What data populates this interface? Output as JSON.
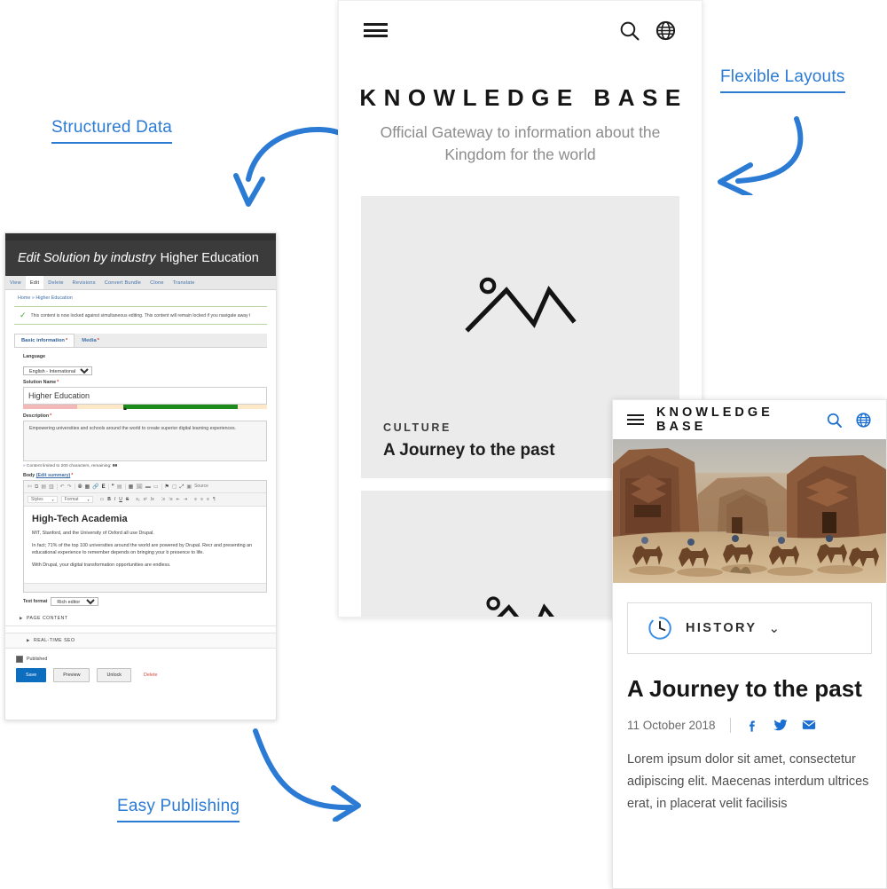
{
  "annotations": [
    {
      "id": "structured",
      "label": "Structured Data"
    },
    {
      "id": "flexible",
      "label": "Flexible Layouts"
    },
    {
      "id": "easy",
      "label": "Easy Publishing"
    }
  ],
  "colors": {
    "annotation_blue": "#2b7bd4",
    "primary_button": "#0d6dbf",
    "delete_link": "#d4483c",
    "required_star": "#d43a2f",
    "link_blue": "#3f6fa8",
    "success_green": "#4d9e3e",
    "social_blue": "#1b6fd0"
  },
  "drupal": {
    "title_emphasis": "Edit Solution by industry",
    "title_name": "Higher Education",
    "tabs": [
      {
        "label": "View",
        "active": false
      },
      {
        "label": "Edit",
        "active": true
      },
      {
        "label": "Delete",
        "active": false
      },
      {
        "label": "Revisions",
        "active": false
      },
      {
        "label": "Convert Bundle",
        "active": false
      },
      {
        "label": "Clone",
        "active": false
      },
      {
        "label": "Translate",
        "active": false
      }
    ],
    "breadcrumb": "Home » Higher Education",
    "status_message": "This content is now locked against simultaneous editing. This content will remain locked if you navigate away f",
    "field_tabs": [
      {
        "label": "Basic information",
        "required": true,
        "active": true
      },
      {
        "label": "Media",
        "required": true,
        "active": false
      }
    ],
    "fields": {
      "language_label": "Language",
      "language_value": "English - International",
      "solution_name_label": "Solution Name",
      "solution_name_value": "Higher Education",
      "description_label": "Description",
      "description_value": "Empowering universities and schools around the world to create superior digital learning experiences.",
      "description_help_prefix": "Content limited to 200 characters, remaining:",
      "description_remaining": "99",
      "body_label": "Body",
      "body_edit_summary": "(Edit summary)",
      "text_format_label": "Text format",
      "text_format_value": "Rich editor"
    },
    "editor": {
      "toolbar_row1": [
        "✂",
        "⧉",
        "📋",
        "🗐",
        "↶",
        "↷",
        "🔍",
        "🔁",
        "🔗",
        "E",
        "❞",
        "⬚",
        "▦",
        "🏳",
        "▬",
        "▭",
        "⚑",
        "⬚",
        "⤧",
        "Source"
      ],
      "toolbar_row2_styles": "Styles",
      "toolbar_row2_format": "Format",
      "toolbar_row2_items": [
        "▭",
        "B",
        "I",
        "U",
        "S",
        "x₂",
        "x²",
        "Ix",
        "⁝≡",
        "⁞≡",
        "⇤",
        "⇥",
        "≡",
        "≡",
        "≡",
        "¶"
      ],
      "heading": "High-Tech Academia",
      "paragraphs": [
        "MIT, Stanford, and the University of Oxford all use Drupal.",
        "In fact; 71% of the top 100 universities around the world are powered by Drupal. Recr and presenting an educational experience to remember depends on bringing your b presence to life.",
        "With Drupal, your digital transformation opportunities are endless."
      ]
    },
    "collapsibles": [
      {
        "label": "PAGE CONTENT"
      },
      {
        "label": "REAL-TIME SEO"
      }
    ],
    "published_label": "Published",
    "buttons": [
      {
        "label": "Save",
        "style": "primary"
      },
      {
        "label": "Preview",
        "style": "default"
      },
      {
        "label": "Unlock",
        "style": "default"
      },
      {
        "label": "Delete",
        "style": "link"
      }
    ]
  },
  "center_mock": {
    "brand": "KNOWLEDGE BASE",
    "tagline": "Official Gateway to information about the Kingdom for the world",
    "icons": {
      "menu": "hamburger-icon",
      "search": "search-icon",
      "globe": "globe-icon"
    },
    "card1": {
      "kicker": "CULTURE",
      "title": "A Journey to the past",
      "image": "mountain-placeholder-icon"
    },
    "card2": {
      "image": "mountain-placeholder-icon"
    }
  },
  "right_mock": {
    "brand": "KNOWLEDGE BASE",
    "icons": {
      "menu": "hamburger-icon",
      "search": "search-icon",
      "globe": "globe-icon",
      "clock": "clock-icon"
    },
    "photo_alt": "Desert rock formations with camel riders",
    "category": "HISTORY",
    "title": "A Journey to the past",
    "date": "11 October 2018",
    "social": [
      "facebook-icon",
      "twitter-icon",
      "email-icon"
    ],
    "body": "Lorem ipsum dolor sit amet, consectetur adipiscing elit. Maecenas interdum ultrices erat, in placerat velit facilisis"
  }
}
